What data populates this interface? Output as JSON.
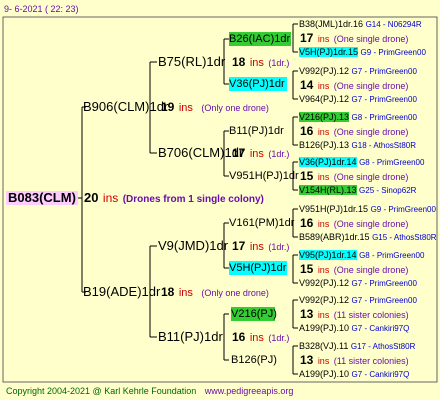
{
  "header": {
    "date": "9-  6-2021 ( 22: 23)"
  },
  "footer": {
    "copyright": "Copyright 2004-2021 @ Karl Kehrle Foundation",
    "site": "www.pedigreeapis.org"
  },
  "root": {
    "name": "B083(CLM)",
    "num": "20",
    "ins": "ins",
    "note": "(Drones from 1 single colony)"
  },
  "gen1": [
    {
      "name": "B906(CLM)1dr",
      "num": "19",
      "ins": "ins",
      "note": "(Only one drone)"
    },
    {
      "name": "B19(ADE)1dr",
      "num": "18",
      "ins": "ins",
      "note": "(Only one drone)"
    }
  ],
  "gen2": [
    {
      "name": "B75(RL)1dr",
      "num": "18",
      "ins": "ins",
      "note": "(1dr.)"
    },
    {
      "name": "B706(CLM)1dr",
      "num": "17",
      "ins": "ins",
      "note": "(1dr.)"
    },
    {
      "name": "V9(JMD)1dr",
      "num": "17",
      "ins": "ins",
      "note": "(1dr.)"
    },
    {
      "name": "B11(PJ)1dr",
      "num": "16",
      "ins": "ins",
      "note": "(1dr.)"
    }
  ],
  "gen3": [
    {
      "name": "B26(IAC)1dr",
      "num": "17",
      "ins": "ins",
      "note": "(One single drone)"
    },
    {
      "name": "V36(PJ)1dr",
      "num": "14",
      "ins": "ins",
      "note": "(One single drone)"
    },
    {
      "name": "B11(PJ)1dr",
      "num": "16",
      "ins": "ins",
      "note": "(One single drone)"
    },
    {
      "name": "V951H(PJ)1dr",
      "num": "15",
      "ins": "ins",
      "note": "(One single drone)"
    },
    {
      "name": "V161(PM)1dr",
      "num": "16",
      "ins": "ins",
      "note": "(One single drone)"
    },
    {
      "name": "V5H(PJ)1dr",
      "num": "15",
      "ins": "ins",
      "note": "(One single drone)"
    },
    {
      "name": "V216(PJ)",
      "num": "13",
      "ins": "ins",
      "note": "(11 sister colonies)"
    },
    {
      "name": "B126(PJ)",
      "num": "13",
      "ins": "ins",
      "note": "(11 sister colonies)"
    }
  ],
  "gen4": [
    {
      "name": "B38(JML)1dr.16",
      "code": "G14 - N06294R"
    },
    {
      "name": "V5H(PJ)1dr.15",
      "code": "G9 - PrimGreen00"
    },
    {
      "name": "V992(PJ).12",
      "code": "G7 - PrimGreen00"
    },
    {
      "name": "V964(PJ).12",
      "code": "G7 - PrimGreen00"
    },
    {
      "name": "V216(PJ).13",
      "code": "G8 - PrimGreen00"
    },
    {
      "name": "B126(PJ).13",
      "code": "G18 - AthosSt80R"
    },
    {
      "name": "V36(PJ)1dr.14",
      "code": "G8 - PrimGreen00"
    },
    {
      "name": "V154H(RL).13",
      "code": "G25 - Sinop62R"
    },
    {
      "name": "V951H(PJ)1dr.15",
      "code": "G9 - PrimGreen00"
    },
    {
      "name": "B589(ABR)1dr.15",
      "code": "G15 - AthosSt80R"
    },
    {
      "name": "V95(PJ)1dr.14",
      "code": "G8 - PrimGreen00"
    },
    {
      "name": "V992(PJ).12",
      "code": "G7 - PrimGreen00"
    },
    {
      "name": "V992(PJ).12",
      "code": "G7 - PrimGreen00"
    },
    {
      "name": "A199(PJ).10",
      "code": "G7 - Cankiri97Q"
    },
    {
      "name": "B328(VJ).11",
      "code": "G17 - AthosSt80R"
    },
    {
      "name": "A199(PJ).10",
      "code": "G7 - Cankiri97Q"
    }
  ]
}
